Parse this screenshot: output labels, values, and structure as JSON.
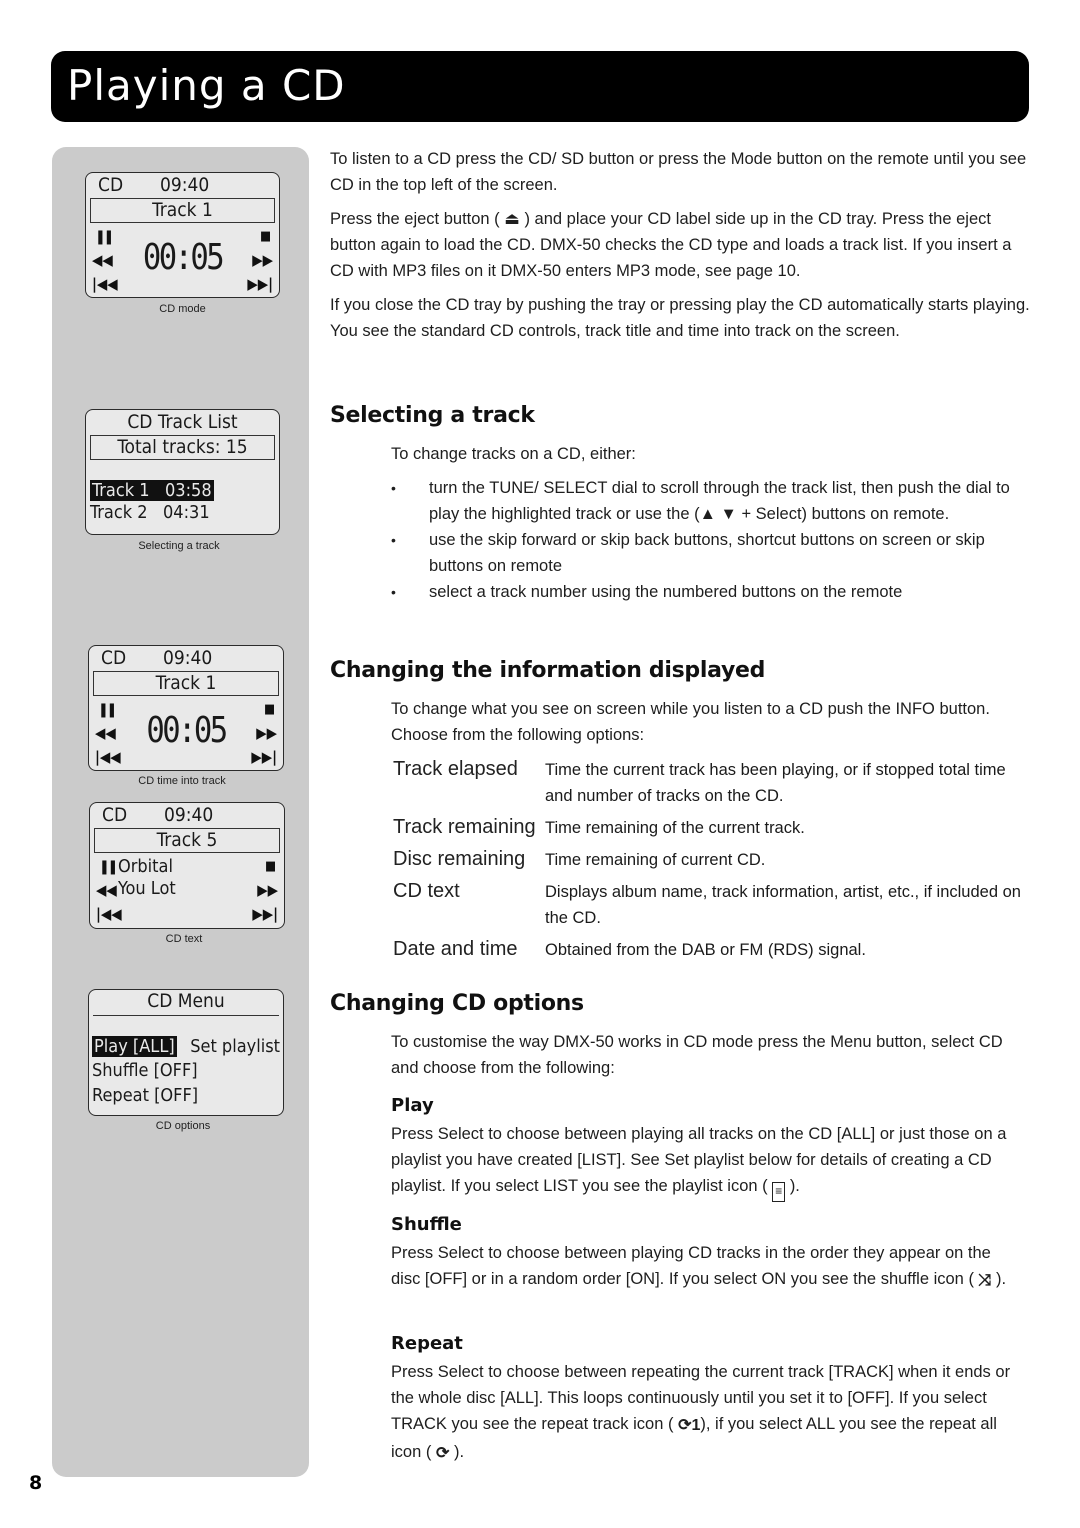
{
  "page": {
    "title": "Playing a CD",
    "page_number": "8"
  },
  "screens": {
    "cd_mode": {
      "mode": "CD",
      "clock": "09:40",
      "track": "Track 1",
      "time": "00:05",
      "caption": "CD mode"
    },
    "track_list": {
      "heading": "CD Track List",
      "total": "Total tracks: 15",
      "rows": [
        {
          "label": "Track 1   03:58",
          "highlighted": true
        },
        {
          "label": "Track 2   04:31",
          "highlighted": false
        }
      ],
      "caption": "Selecting a track"
    },
    "time_into_track": {
      "mode": "CD",
      "clock": "09:40",
      "track": "Track 1",
      "time": "00:05",
      "caption": "CD time into track"
    },
    "cd_text": {
      "mode": "CD",
      "clock": "09:40",
      "track": "Track 5",
      "artist": "Orbital",
      "title": "You Lot",
      "caption": "CD text"
    },
    "cd_menu": {
      "heading": "CD Menu",
      "items": [
        {
          "label": "Play [ALL]",
          "highlighted": true
        },
        {
          "label": "Shuffle [OFF]",
          "highlighted": false
        },
        {
          "label": "Repeat [OFF]",
          "highlighted": false
        }
      ],
      "side_item": "Set playlist",
      "caption": "CD options"
    }
  },
  "icons": {
    "pause": "❚❚",
    "rewind": "◀◀",
    "prev": "|◀◀",
    "stop": "■",
    "fast_forward": "▶▶",
    "next": "▶▶|",
    "eject": "⏏",
    "bullet": "•",
    "up": "▲",
    "down": "▼",
    "playlist": "≡",
    "shuffle": "⤨",
    "repeat_track": "⟳1",
    "repeat_all": "⟳"
  },
  "intro": {
    "p1": "To listen to a CD press the CD/ SD button or press the Mode button on the remote until you see CD in the top left of the screen.",
    "p2_a": "Press the eject button (",
    "p2_b": ") and place your CD label side up in the CD tray. Press the eject button again to load the CD. DMX-50 checks the CD type and loads a track list. If you insert a CD with MP3 files on it DMX-50 enters MP3 mode, see page 10.",
    "p3": "If you close the CD tray by pushing the tray or pressing play the CD automatically starts playing. You see the standard CD controls, track title and time into track on the screen."
  },
  "selecting": {
    "heading": "Selecting a track",
    "intro": "To change tracks on a CD, either:",
    "bullets": [
      {
        "a": "turn the TUNE/ SELECT dial to scroll through the track list, then push the dial to play the highlighted track or use the (",
        "b": " + Select) buttons on remote."
      },
      {
        "a": "use the skip forward or skip back buttons, shortcut buttons on screen or skip buttons on remote",
        "b": ""
      },
      {
        "a": "select a track number using the numbered buttons on the remote",
        "b": ""
      }
    ]
  },
  "info": {
    "heading": "Changing the information displayed",
    "intro": "To change what you see on screen while you listen to a CD push the INFO button. Choose from the following options:",
    "options": [
      {
        "term": "Track elapsed",
        "desc": "Time the current track has been playing, or if stopped total time and number of tracks on the CD."
      },
      {
        "term": "Track remaining",
        "desc": "Time remaining of the current track."
      },
      {
        "term": "Disc remaining",
        "desc": "Time remaining of current CD."
      },
      {
        "term": "CD text",
        "desc": "Displays album name, track information, artist, etc., if included on the CD."
      },
      {
        "term": "Date and time",
        "desc": "Obtained from the DAB or FM (RDS) signal."
      }
    ]
  },
  "options": {
    "heading": "Changing CD options",
    "intro": "To customise the way DMX-50 works in CD mode press the Menu button, select CD and choose from the following:",
    "play": {
      "heading": "Play",
      "text_a": "Press Select to choose between playing all tracks on the CD [ALL] or just those on a playlist you have created [LIST]. See Set playlist below for details of creating a CD playlist. If you select LIST you see the playlist icon (",
      "text_b": ")."
    },
    "shuffle": {
      "heading": "Shuffle",
      "text_a": "Press Select to choose between playing CD tracks in the order they appear on the disc [OFF] or in a random order [ON]. If you select ON you see the shuffle icon (",
      "text_b": ")."
    },
    "repeat": {
      "heading": "Repeat",
      "text_a": "Press Select to choose between repeating the current track [TRACK] when it ends or the whole disc [ALL]. This loops continuously until you set it to [OFF]. If you select TRACK you see the repeat track icon (",
      "text_b": "), if you select ALL you see the repeat all icon (",
      "text_c": ")."
    }
  }
}
